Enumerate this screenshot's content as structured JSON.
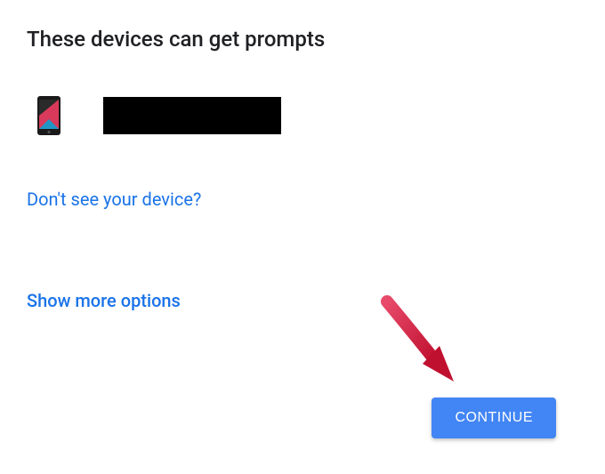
{
  "heading": "These devices can get prompts",
  "device": {
    "name_redacted": true,
    "icon": "phone-icon"
  },
  "links": {
    "dont_see_device": "Don't see your device?",
    "show_more_options": "Show more options"
  },
  "continue_button": "CONTINUE",
  "colors": {
    "link": "#1a73e8",
    "button_bg": "#4285f4",
    "text": "#202124",
    "annotation_arrow": "#d8213b"
  }
}
